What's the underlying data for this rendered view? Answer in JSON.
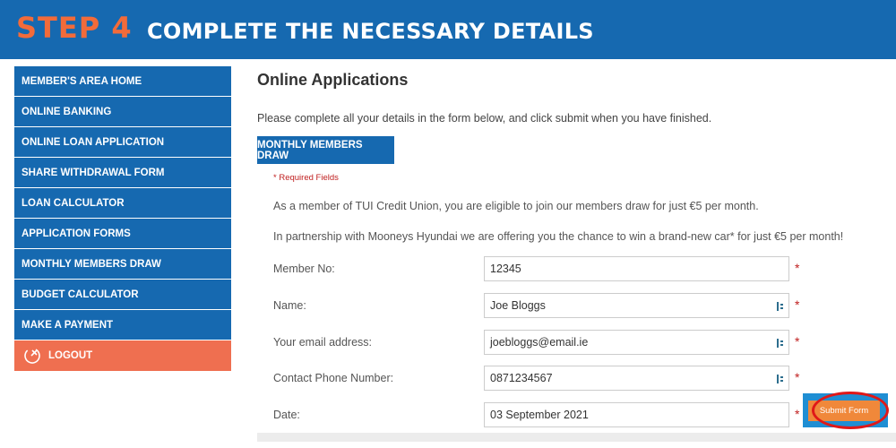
{
  "banner": {
    "step": "STEP 4",
    "title": "COMPLETE THE NECESSARY DETAILS"
  },
  "sidebar": {
    "items": [
      {
        "label": "MEMBER'S AREA HOME"
      },
      {
        "label": "ONLINE BANKING"
      },
      {
        "label": "ONLINE LOAN APPLICATION"
      },
      {
        "label": "SHARE WITHDRAWAL FORM"
      },
      {
        "label": "LOAN CALCULATOR"
      },
      {
        "label": "APPLICATION FORMS"
      },
      {
        "label": "MONTHLY MEMBERS DRAW"
      },
      {
        "label": "BUDGET CALCULATOR"
      },
      {
        "label": "MAKE A PAYMENT"
      }
    ],
    "logout_label": "LOGOUT",
    "logout_icon": "power-icon"
  },
  "main": {
    "title": "Online Applications",
    "intro": "Please complete all your details in the form below, and click submit when you have finished.",
    "tab_label": "MONTHLY MEMBERS DRAW",
    "required_note": "* Required Fields",
    "paragraph1": "As a member of TUI Credit Union, you are eligible to join our members draw for just €5 per month.",
    "paragraph2": "In partnership with Mooneys Hyundai we are offering you the chance to win a brand-new car* for just €5 per month!",
    "fields": [
      {
        "label": "Member No:",
        "value": "12345"
      },
      {
        "label": "Name:",
        "value": "Joe Bloggs"
      },
      {
        "label": "Your email address:",
        "value": "joebloggs@email.ie"
      },
      {
        "label": "Contact Phone Number:",
        "value": "0871234567"
      },
      {
        "label": "Date:",
        "value": "03 September 2021"
      }
    ],
    "required_star": "*",
    "submit_label": "Submit Form"
  },
  "colors": {
    "brand_blue": "#1669b0",
    "accent_orange": "#f26b3a",
    "logout_bg": "#ef6f50",
    "submit_bg": "#f0883a",
    "highlight_red": "#e01818"
  }
}
